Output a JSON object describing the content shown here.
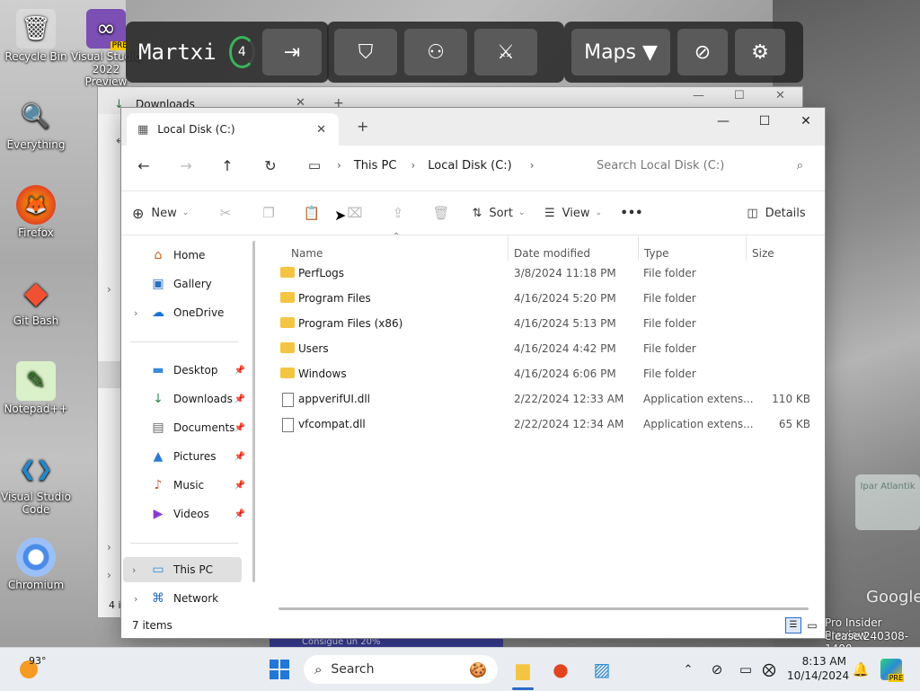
{
  "desktop": {
    "icons": [
      {
        "label": "Recycle Bin",
        "glyph": "🗑"
      },
      {
        "label": "Visual Studio 2022 Preview",
        "glyph": "∞",
        "badge": "PRE"
      },
      {
        "label": "Everything",
        "glyph": "🔍"
      },
      {
        "label": "Firefox",
        "glyph": "🦊"
      },
      {
        "label": "Git Bash",
        "glyph": "◆"
      },
      {
        "label": "Notepad++",
        "glyph": "✎"
      },
      {
        "label": "Visual Studio Code",
        "glyph": "❮❯"
      },
      {
        "label": "Chromium",
        "glyph": "◎"
      }
    ],
    "watermark_line1": "Pro Insider Preview",
    "watermark_line2": "elease.240308-1400",
    "map_label": "Google",
    "map_sign": "Ipar Atlantik",
    "ad_text": "Consigue un 20%"
  },
  "overlay": {
    "player_name": "Martxi",
    "level": "4",
    "maps_label": "Maps ▼"
  },
  "back_window": {
    "tab_title": "Downloads",
    "status_fragment": "4 i"
  },
  "window": {
    "tab_title": "Local Disk (C:)",
    "new_tab": "+",
    "breadcrumb": [
      "This PC",
      "Local Disk (C:)"
    ],
    "search_placeholder": "Search Local Disk (C:)",
    "toolbar": {
      "new_label": "New",
      "sort_label": "Sort",
      "view_label": "View",
      "more_label": "•••",
      "details_label": "Details"
    },
    "nav": {
      "quick": [
        {
          "label": "Home",
          "icon": "⌂"
        },
        {
          "label": "Gallery",
          "icon": "▣"
        },
        {
          "label": "OneDrive",
          "icon": "☁"
        }
      ],
      "pinned": [
        {
          "label": "Desktop",
          "icon": "▬"
        },
        {
          "label": "Downloads",
          "icon": "↓"
        },
        {
          "label": "Documents",
          "icon": "▤"
        },
        {
          "label": "Pictures",
          "icon": "▲"
        },
        {
          "label": "Music",
          "icon": "♪"
        },
        {
          "label": "Videos",
          "icon": "▶"
        }
      ],
      "bottom": [
        {
          "label": "This PC",
          "icon": "▭"
        },
        {
          "label": "Network",
          "icon": "⌘"
        }
      ]
    },
    "columns": {
      "name": "Name",
      "date": "Date modified",
      "type": "Type",
      "size": "Size"
    },
    "files": [
      {
        "name": "PerfLogs",
        "date": "3/8/2024 11:18 PM",
        "type": "File folder",
        "size": "",
        "kind": "folder"
      },
      {
        "name": "Program Files",
        "date": "4/16/2024 5:20 PM",
        "type": "File folder",
        "size": "",
        "kind": "folder"
      },
      {
        "name": "Program Files (x86)",
        "date": "4/16/2024 5:13 PM",
        "type": "File folder",
        "size": "",
        "kind": "folder"
      },
      {
        "name": "Users",
        "date": "4/16/2024 4:42 PM",
        "type": "File folder",
        "size": "",
        "kind": "folder"
      },
      {
        "name": "Windows",
        "date": "4/16/2024 6:06 PM",
        "type": "File folder",
        "size": "",
        "kind": "folder"
      },
      {
        "name": "appverifUI.dll",
        "date": "2/22/2024 12:33 AM",
        "type": "Application extens...",
        "size": "110 KB",
        "kind": "file"
      },
      {
        "name": "vfcompat.dll",
        "date": "2/22/2024 12:34 AM",
        "type": "Application extens...",
        "size": "65 KB",
        "kind": "file"
      }
    ],
    "status": "7 items"
  },
  "taskbar": {
    "weather_temp": "93°",
    "search_label": "Search",
    "time": "8:13 AM",
    "date": "10/14/2024",
    "pre_badge": "PRE"
  }
}
